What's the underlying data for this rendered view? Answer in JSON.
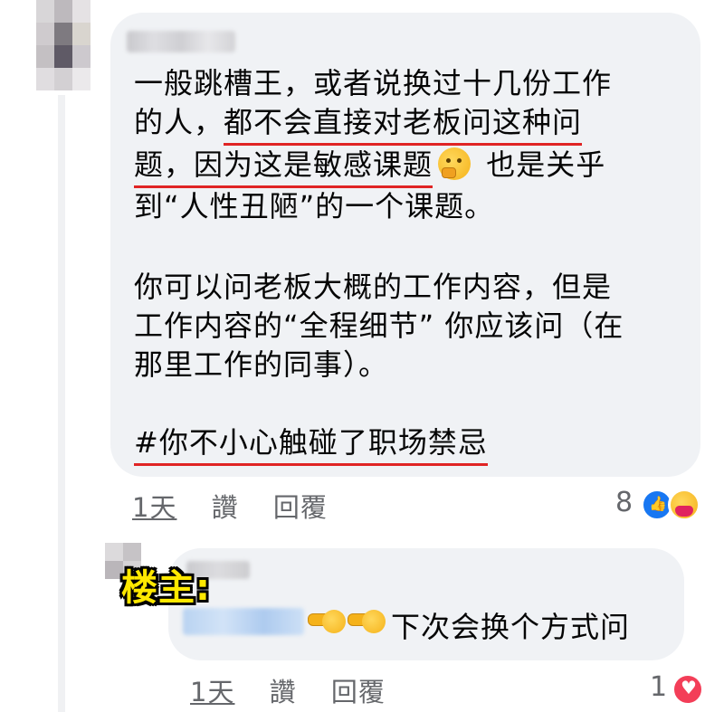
{
  "comment": {
    "lines": [
      "一般跳槽王，或者说换过十几份工作",
      "的人，",
      "都不会直接对老板问这种问",
      "题，因为这是敏感课题",
      " 也是关乎",
      "到“人性丑陋”的一个课题。",
      "你可以问老板大概的工作内容，但是",
      "工作内容的“全程细节” 你应该问（在",
      "那里工作的同事）。",
      "#你不小心触碰了职场禁忌"
    ],
    "emoji": "thinking-face-icon",
    "time": "1天",
    "like_label": "讚",
    "reply_label": "回覆",
    "reaction_count": "8"
  },
  "reply": {
    "op_label": "楼主:",
    "text": "下次会换个方式问",
    "time": "1天",
    "like_label": "讚",
    "reply_label": "回覆",
    "reaction_count": "1"
  },
  "colors": {
    "bubble": "#f0f2f5",
    "underline": "#e02424",
    "meta": "#65676b",
    "like": "#1877f2",
    "love": "#f33e58",
    "op_label": "#ffe800"
  }
}
